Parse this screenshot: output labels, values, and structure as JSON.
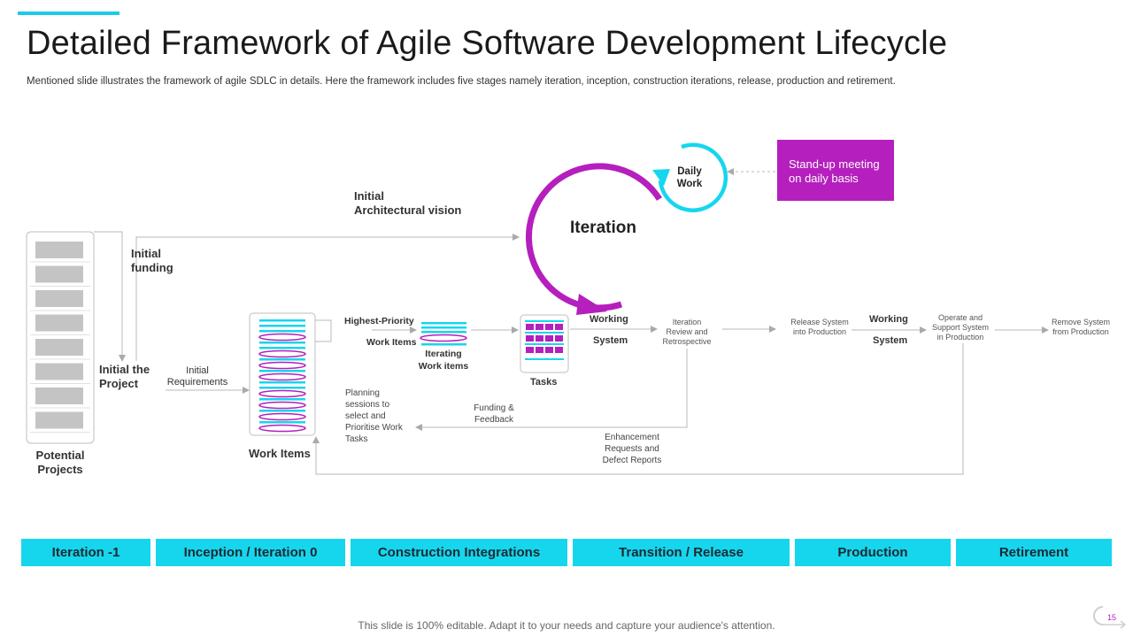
{
  "slide": {
    "title": "Detailed Framework of Agile Software Development Lifecycle",
    "subtitle": "Mentioned slide illustrates the framework of agile SDLC in details. Here the framework includes five stages namely iteration, inception, construction iterations, release, production and retirement.",
    "footer": "This slide is 100% editable. Adapt it to your needs and capture your audience's attention.",
    "page_number": "15"
  },
  "diagram": {
    "potential_projects": "Potential\nProjects",
    "initial_the_project": "Initial the\nProject",
    "initial_funding": "Initial\nfunding",
    "initial_arch_vision": "Initial\nArchitectural vision",
    "initial_requirements": "Initial\nRequirements",
    "work_items": "Work Items",
    "highest_priority": "Highest-Priority",
    "work_items_small": "Work Items",
    "iterating_work_items": "Iterating\nWork items",
    "tasks": "Tasks",
    "working_1": "Working",
    "system_1": "System",
    "iteration": "Iteration",
    "daily_work": "Daily\nWork",
    "stand_up": "Stand-up meeting\non daily basis",
    "iteration_review": "Iteration\nReview and\nRetrospective",
    "release_system": "Release System\ninto Production",
    "working_2": "Working",
    "system_2": "System",
    "operate_support": "Operate and\nSupport System\nin Production",
    "remove_system": "Remove System\nfrom Production",
    "planning_sessions": "Planning\nsessions to\nselect and\nPrioritise Work\nTasks",
    "funding_feedback": "Funding &\nFeedback",
    "enhancement_requests": "Enhancement\nRequests and\nDefect Reports"
  },
  "phases": [
    "Iteration -1",
    "Inception / Iteration 0",
    "Construction Integrations",
    "Transition / Release",
    "Production",
    "Retirement"
  ],
  "colors": {
    "accent_cyan": "#16d6ee",
    "accent_magenta": "#b51fbd",
    "gray_block": "#c4c4c4",
    "connector": "#b0b0b0"
  }
}
